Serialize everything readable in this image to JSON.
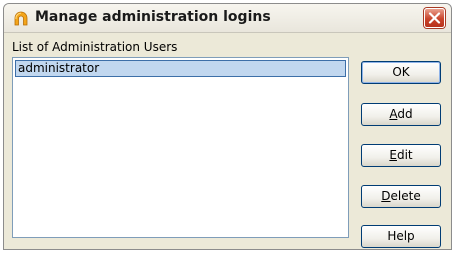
{
  "window": {
    "title": "Manage administration logins",
    "accent_color": "#c9442b"
  },
  "list": {
    "label": "List of Administration Users",
    "items": [
      "administrator"
    ],
    "selected_index": 0
  },
  "buttons": {
    "ok": "OK",
    "add_accel": "A",
    "add_rest": "dd",
    "edit_accel": "E",
    "edit_rest": "dit",
    "delete_accel": "D",
    "delete_rest": "elete",
    "help": "Help"
  },
  "icons": {
    "app": "arch-icon",
    "close": "close-icon"
  }
}
